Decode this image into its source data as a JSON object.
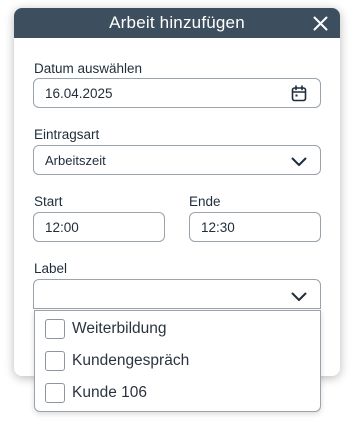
{
  "dialog": {
    "title": "Arbeit hinzufügen"
  },
  "date": {
    "label": "Datum auswählen",
    "value": "16.04.2025"
  },
  "entry_type": {
    "label": "Eintragsart",
    "value": "Arbeitszeit"
  },
  "start": {
    "label": "Start",
    "value": "12:00"
  },
  "end": {
    "label": "Ende",
    "value": "12:30"
  },
  "label_field": {
    "label": "Label",
    "value": "",
    "options": [
      {
        "label": "Weiterbildung",
        "checked": false
      },
      {
        "label": "Kundengespräch",
        "checked": false
      },
      {
        "label": "Kunde 106",
        "checked": false
      }
    ]
  },
  "colors": {
    "header_bg": "#3d4f5e",
    "border": "#9aa3ab",
    "text": "#1f2d3a"
  },
  "icons": [
    "close-icon",
    "calendar-icon",
    "chevron-down-icon",
    "checkbox"
  ]
}
